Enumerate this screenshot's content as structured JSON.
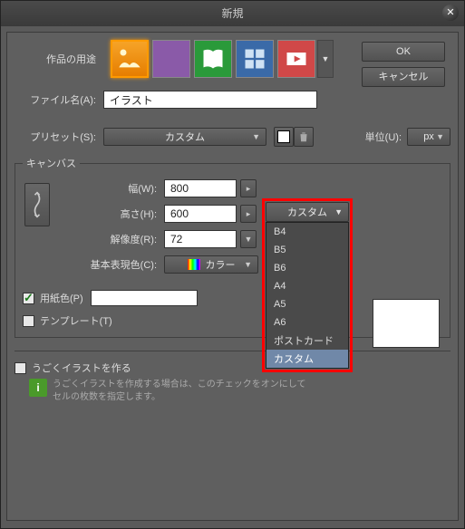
{
  "dialog_title": "新規",
  "buttons": {
    "ok": "OK",
    "cancel": "キャンセル"
  },
  "labels": {
    "purpose": "作品の用途",
    "filename": "ファイル名(A):",
    "preset": "プリセット(S):",
    "unit": "単位(U):",
    "canvas": "キャンバス",
    "width": "幅(W):",
    "height": "高さ(H):",
    "resolution": "解像度(R):",
    "base_color": "基本表現色(C):",
    "paper_color": "用紙色(P)",
    "template": "テンプレート(T)",
    "anim": "うごくイラストを作る",
    "anim_note": "うごくイラストを作成する場合は、このチェックをオンにして\nセルの枚数を指定します。"
  },
  "values": {
    "filename": "イラスト",
    "preset": "カスタム",
    "unit": "px",
    "width": "800",
    "height": "600",
    "resolution": "72",
    "color_mode": "カラー"
  },
  "size_dropdown": {
    "current": "カスタム",
    "options": [
      "B4",
      "B5",
      "B6",
      "A4",
      "A5",
      "A6",
      "ポストカード",
      "カスタム"
    ],
    "selected_index": 7
  },
  "purpose_icons": [
    "illustration",
    "comic",
    "book",
    "print",
    "animation"
  ]
}
